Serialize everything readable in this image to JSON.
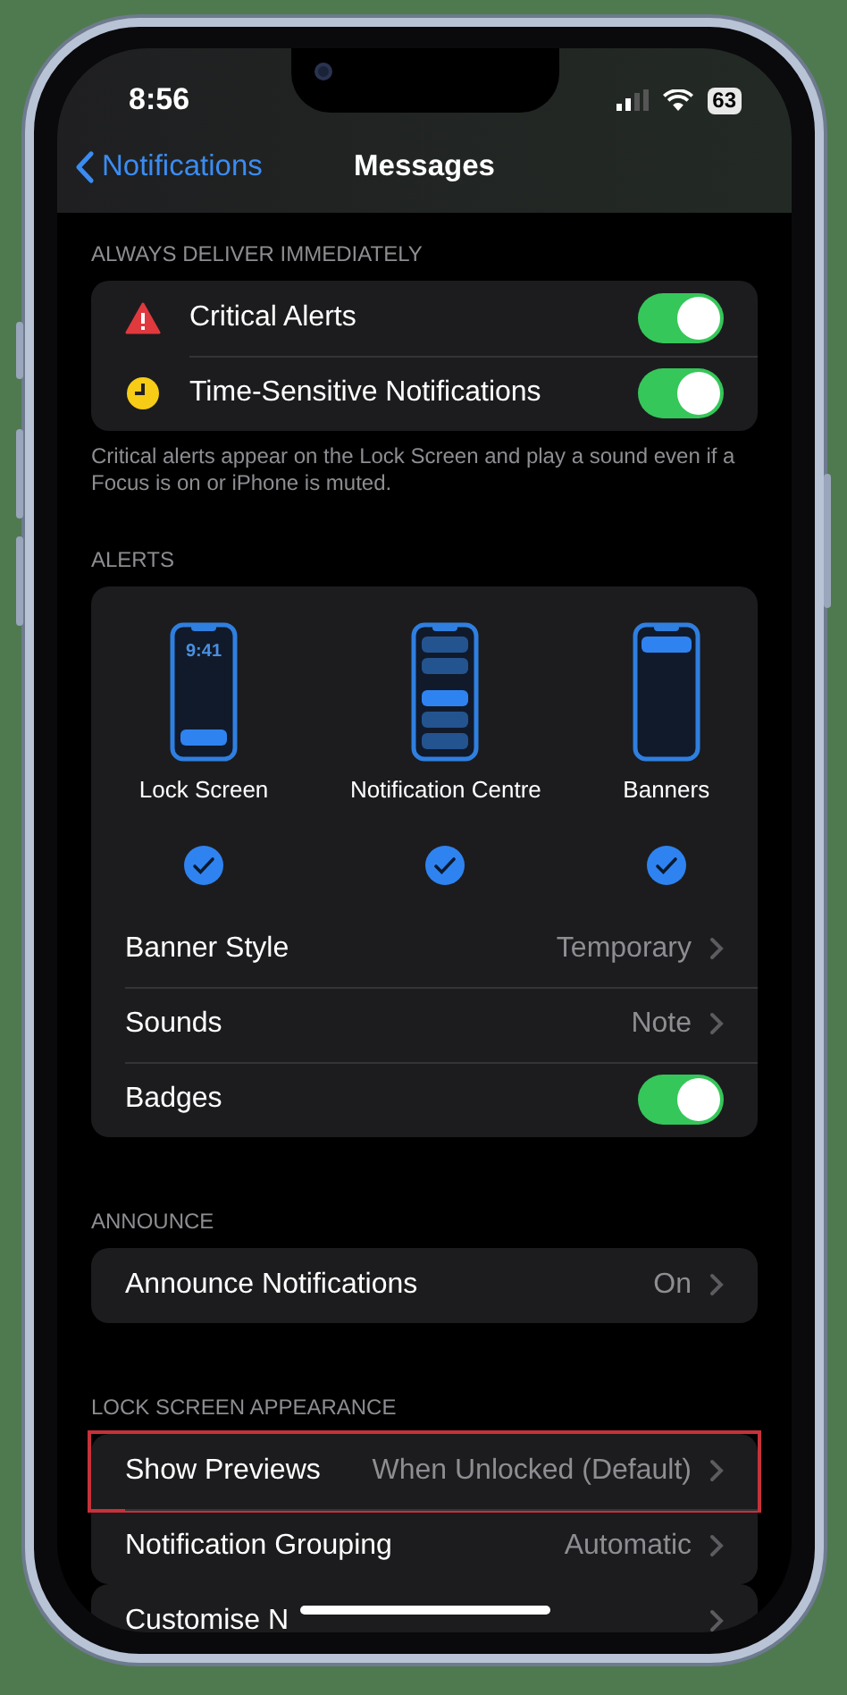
{
  "status_bar": {
    "time": "8:56",
    "battery": "63"
  },
  "nav": {
    "back": "Notifications",
    "title": "Messages"
  },
  "sections": [
    {
      "header": "ALWAYS DELIVER IMMEDIATELY",
      "rows": [
        {
          "kind": "critical",
          "label": "Critical Alerts",
          "on": true
        },
        {
          "kind": "timed",
          "label": "Time-Sensitive Notifications",
          "on": true
        }
      ],
      "footer": "Critical alerts appear on the Lock Screen and play a sound even if a Focus is on or iPhone is muted."
    },
    {
      "header": "ALERTS",
      "rows": [
        {
          "kind": "alerts",
          "styles": [
            {
              "kind": "lock",
              "label": "Lock Screen",
              "clock": "9:41",
              "selected": true
            },
            {
              "kind": "centre",
              "label": "Notification Centre",
              "selected": true
            },
            {
              "kind": "banner",
              "label": "Banners",
              "selected": true
            }
          ]
        },
        {
          "kind": "value",
          "label": "Banner Style",
          "value": "Temporary"
        },
        {
          "kind": "value",
          "label": "Sounds",
          "value": "Note"
        },
        {
          "kind": "toggle",
          "label": "Badges",
          "on": true
        }
      ]
    },
    {
      "header": "ANNOUNCE",
      "rows": [
        {
          "kind": "value",
          "label": "Announce Notifications",
          "value": "On"
        }
      ]
    },
    {
      "header": "LOCK SCREEN APPEARANCE",
      "rows": [
        {
          "kind": "value",
          "label": "Show Previews",
          "value": "When Unlocked (Default)",
          "highlighted": true
        },
        {
          "kind": "value",
          "label": "Notification Grouping",
          "value": "Automatic"
        }
      ]
    },
    {
      "rows": [
        {
          "kind": "value",
          "label": "Customise N"
        }
      ]
    }
  ]
}
